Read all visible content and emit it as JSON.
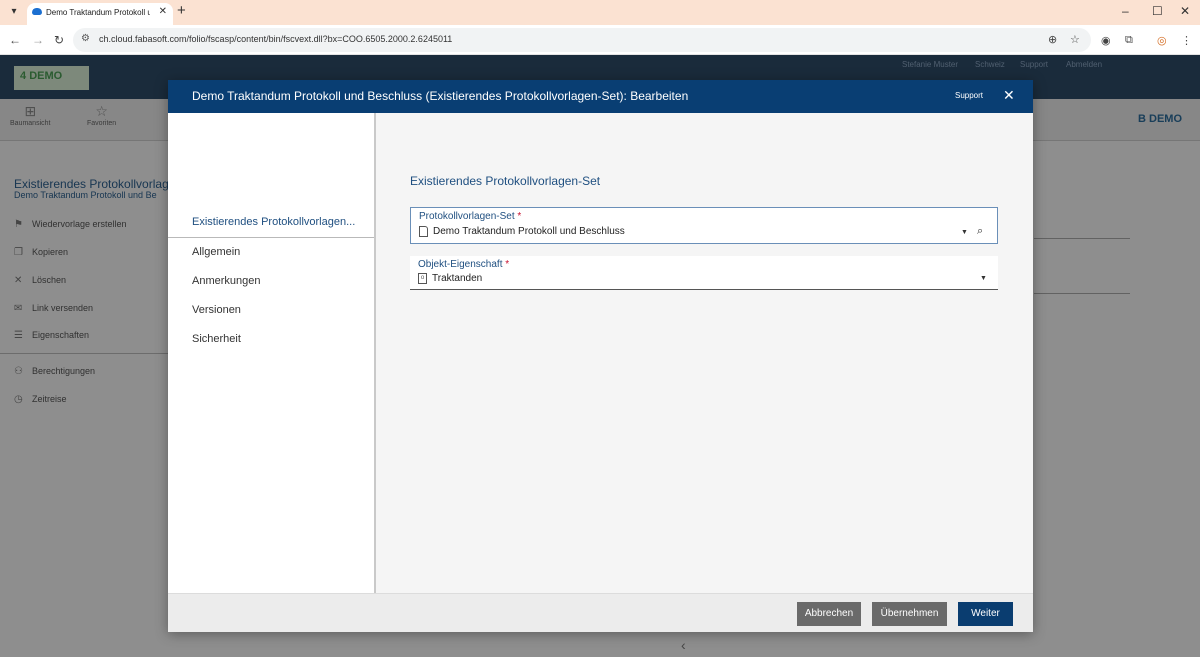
{
  "browser": {
    "tab_title": "Demo Traktandum Protokoll ur",
    "url": "ch.cloud.fabasoft.com/folio/fscasp/content/bin/fscvext.dll?bx=COO.6505.2000.2.6245011"
  },
  "app": {
    "logo_text": "DEMO",
    "header_links": [
      "Stefanie Muster",
      "Schweiz",
      "Support",
      "Abmelden"
    ],
    "toolbar": [
      "Baumansicht",
      "Favoriten"
    ],
    "brand_right": "DEMO",
    "object_title": "Existierendes Protokollvorlage",
    "object_subtitle": "Demo Traktandum Protokoll und Be",
    "menu": [
      "Wiedervorlage erstellen",
      "Kopieren",
      "Löschen",
      "Link versenden",
      "Eigenschaften",
      "Berechtigungen",
      "Zeitreise"
    ]
  },
  "dialog": {
    "title": "Demo Traktandum Protokoll und Beschluss (Existierendes Protokollvorlagen-Set): Bearbeiten",
    "support": "Support",
    "sidebar": [
      "Existierendes Protokollvorlagen...",
      "Allgemein",
      "Anmerkungen",
      "Versionen",
      "Sicherheit"
    ],
    "section_title": "Existierendes Protokollvorlagen-Set",
    "fields": [
      {
        "label": "Protokollvorlagen-Set",
        "required": "*",
        "value": "Demo Traktandum Protokoll und Beschluss"
      },
      {
        "label": "Objekt-Eigenschaft",
        "required": "*",
        "value": "Traktanden"
      }
    ],
    "buttons": {
      "cancel": "Abbrechen",
      "apply": "Übernehmen",
      "next": "Weiter"
    }
  },
  "colors": {
    "accent": "#093e73",
    "required": "#c8102e"
  }
}
